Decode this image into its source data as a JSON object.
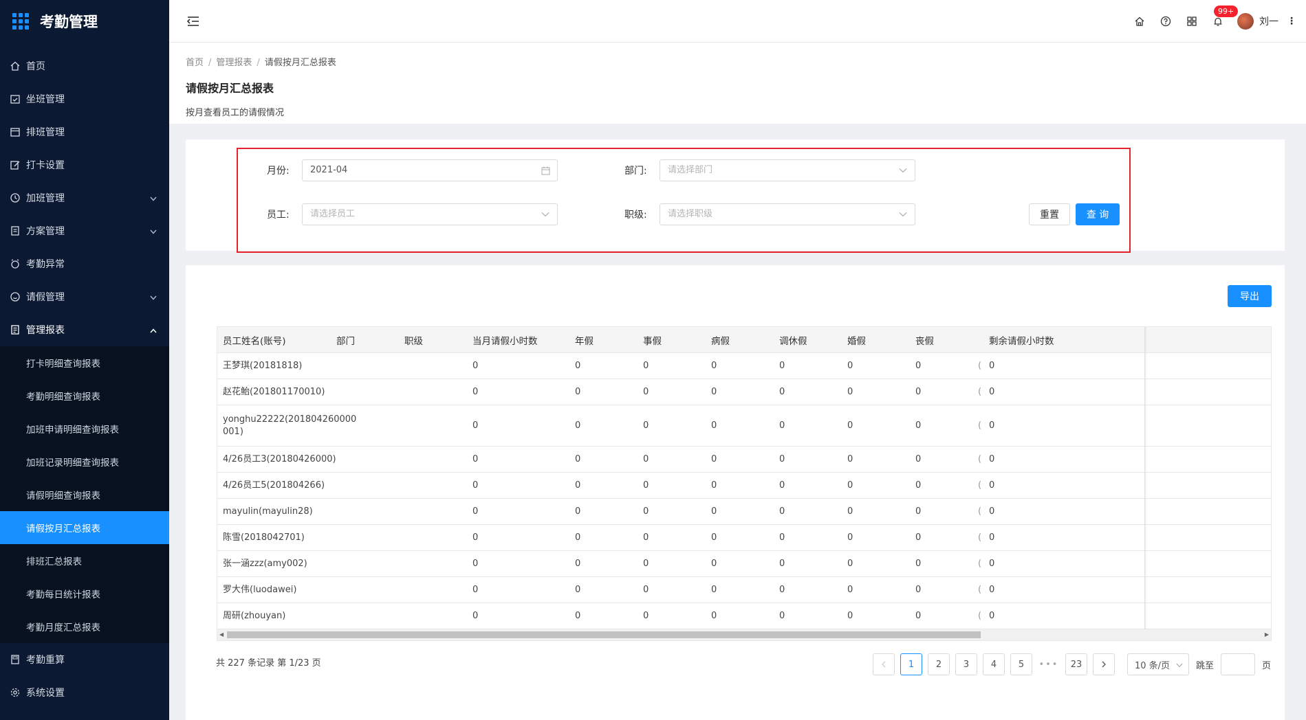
{
  "app": {
    "title": "考勤管理"
  },
  "sidebar": {
    "items": [
      {
        "label": "首页",
        "icon": "home-icon"
      },
      {
        "label": "坐班管理",
        "icon": "calendar-check-icon"
      },
      {
        "label": "排班管理",
        "icon": "calendar-icon"
      },
      {
        "label": "打卡设置",
        "icon": "edit-icon"
      },
      {
        "label": "加班管理",
        "icon": "clock-icon",
        "arrow": "down"
      },
      {
        "label": "方案管理",
        "icon": "file-icon",
        "arrow": "down"
      },
      {
        "label": "考勤异常",
        "icon": "alarm-icon"
      },
      {
        "label": "请假管理",
        "icon": "smile-icon",
        "arrow": "down"
      },
      {
        "label": "管理报表",
        "icon": "report-icon",
        "arrow": "up"
      }
    ],
    "submenu": [
      "打卡明细查询报表",
      "考勤明细查询报表",
      "加班申请明细查询报表",
      "加班记录明细查询报表",
      "请假明细查询报表",
      "请假按月汇总报表",
      "排班汇总报表",
      "考勤每日统计报表",
      "考勤月度汇总报表"
    ],
    "active_sub": "请假按月汇总报表",
    "bottom_items": [
      {
        "label": "考勤重算",
        "icon": "calculator-icon"
      },
      {
        "label": "系统设置",
        "icon": "gear-icon"
      }
    ]
  },
  "header": {
    "badge": "99+",
    "username": "刘一"
  },
  "breadcrumb": [
    "首页",
    "管理报表",
    "请假按月汇总报表"
  ],
  "page": {
    "title": "请假按月汇总报表",
    "description": "按月查看员工的请假情况"
  },
  "filters": {
    "month_label": "月份:",
    "month_value": "2021-04",
    "dept_label": "部门:",
    "dept_placeholder": "请选择部门",
    "employee_label": "员工:",
    "employee_placeholder": "请选择员工",
    "level_label": "职级:",
    "level_placeholder": "请选择职级",
    "reset_label": "重置",
    "query_label": "查 询"
  },
  "table": {
    "export_label": "导出",
    "columns": [
      "员工姓名(账号)",
      "部门",
      "职级",
      "当月请假小时数",
      "年假",
      "事假",
      "病假",
      "调休假",
      "婚假",
      "丧假",
      "剩余请假小时数"
    ],
    "rows": [
      {
        "name": "王梦琪(20181818)",
        "dept": "",
        "level": "",
        "hours": "0",
        "annual": "0",
        "personal": "0",
        "sick": "0",
        "comp": "0",
        "marriage": "0",
        "funeral": "0",
        "cut": "(",
        "remain": "0"
      },
      {
        "name": "赵花鲐(201801170010)",
        "dept": "",
        "level": "",
        "hours": "0",
        "annual": "0",
        "personal": "0",
        "sick": "0",
        "comp": "0",
        "marriage": "0",
        "funeral": "0",
        "cut": "(",
        "remain": "0"
      },
      {
        "name": "yonghu22222(201804260000001)",
        "name_line1": "yonghu22222(201804260000",
        "name_line2": "001)",
        "dept": "",
        "level": "",
        "hours": "0",
        "annual": "0",
        "personal": "0",
        "sick": "0",
        "comp": "0",
        "marriage": "0",
        "funeral": "0",
        "cut": "(",
        "remain": "0"
      },
      {
        "name": "4/26员工3(20180426000)",
        "dept": "",
        "level": "",
        "hours": "0",
        "annual": "0",
        "personal": "0",
        "sick": "0",
        "comp": "0",
        "marriage": "0",
        "funeral": "0",
        "cut": "(",
        "remain": "0"
      },
      {
        "name": "4/26员工5(201804266)",
        "dept": "",
        "level": "",
        "hours": "0",
        "annual": "0",
        "personal": "0",
        "sick": "0",
        "comp": "0",
        "marriage": "0",
        "funeral": "0",
        "cut": "(",
        "remain": "0"
      },
      {
        "name": "mayulin(mayulin28)",
        "dept": "",
        "level": "",
        "hours": "0",
        "annual": "0",
        "personal": "0",
        "sick": "0",
        "comp": "0",
        "marriage": "0",
        "funeral": "0",
        "cut": "(",
        "remain": "0"
      },
      {
        "name": "陈雪(2018042701)",
        "dept": "",
        "level": "",
        "hours": "0",
        "annual": "0",
        "personal": "0",
        "sick": "0",
        "comp": "0",
        "marriage": "0",
        "funeral": "0",
        "cut": "(",
        "remain": "0"
      },
      {
        "name": "张一涵zzz(amy002)",
        "dept": "",
        "level": "",
        "hours": "0",
        "annual": "0",
        "personal": "0",
        "sick": "0",
        "comp": "0",
        "marriage": "0",
        "funeral": "0",
        "cut": "(",
        "remain": "0"
      },
      {
        "name": "罗大伟(luodawei)",
        "dept": "",
        "level": "",
        "hours": "0",
        "annual": "0",
        "personal": "0",
        "sick": "0",
        "comp": "0",
        "marriage": "0",
        "funeral": "0",
        "cut": "(",
        "remain": "0"
      },
      {
        "name": "周研(zhouyan)",
        "dept": "",
        "level": "",
        "hours": "0",
        "annual": "0",
        "personal": "0",
        "sick": "0",
        "comp": "0",
        "marriage": "0",
        "funeral": "0",
        "cut": "(",
        "remain": "0"
      }
    ]
  },
  "pagination": {
    "summary": "共 227 条记录 第 1/23 页",
    "pages": [
      "1",
      "2",
      "3",
      "4",
      "5"
    ],
    "ellipsis": "•••",
    "last_page": "23",
    "current_page": "1",
    "page_size": "10 条/页",
    "jump_label": "跳至",
    "page_suffix": "页"
  },
  "colors": {
    "sidebar_bg": "#0b1a32",
    "accent": "#1890ff",
    "highlight_box": "#e8202a"
  }
}
